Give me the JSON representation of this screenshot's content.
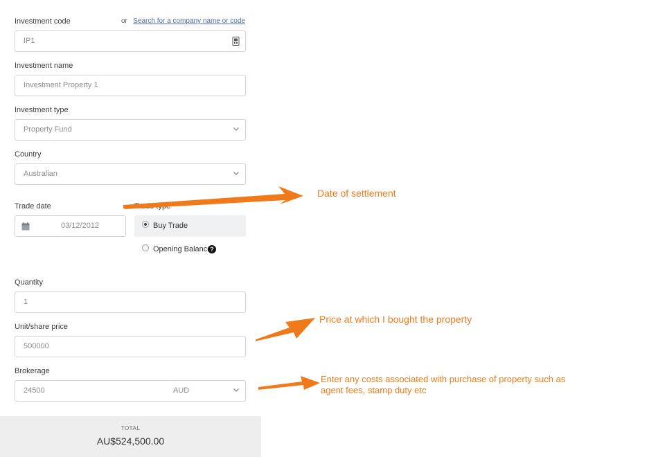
{
  "investment_code": {
    "label": "Investment code",
    "or_text": "or",
    "search_link": "Search for a company name or code",
    "value": "IP1",
    "icon": "keypad-icon"
  },
  "investment_name": {
    "label": "Investment name",
    "value": "Investment Property 1"
  },
  "investment_type": {
    "label": "Investment type",
    "value": "Property Fund"
  },
  "country": {
    "label": "Country",
    "value": "Australian"
  },
  "trade_date": {
    "label": "Trade date",
    "value": "03/12/2012",
    "icon": "calendar-icon"
  },
  "trade_type": {
    "label": "Trade type",
    "options": [
      {
        "label": "Buy Trade",
        "selected": true
      },
      {
        "label": "Opening Balance",
        "selected": false
      }
    ],
    "help_icon": "help-icon"
  },
  "quantity": {
    "label": "Quantity",
    "value": "1"
  },
  "unit_price": {
    "label": "Unit/share price",
    "value": "500000"
  },
  "brokerage": {
    "label": "Brokerage",
    "value": "24500",
    "currency": "AUD"
  },
  "total": {
    "label": "TOTAL",
    "value": "AU$524,500.00"
  },
  "annotations": {
    "settlement": "Date of settlement",
    "price": "Price at which I bought the property",
    "costs_line1": "Enter any costs associated with purchase of property such as",
    "costs_line2": "agent fees, stamp duty etc"
  },
  "colors": {
    "annotation": "#f07a1a",
    "border": "#cfd3d6",
    "selected_bg": "#eff0f1",
    "total_bg": "#eeeeee"
  }
}
